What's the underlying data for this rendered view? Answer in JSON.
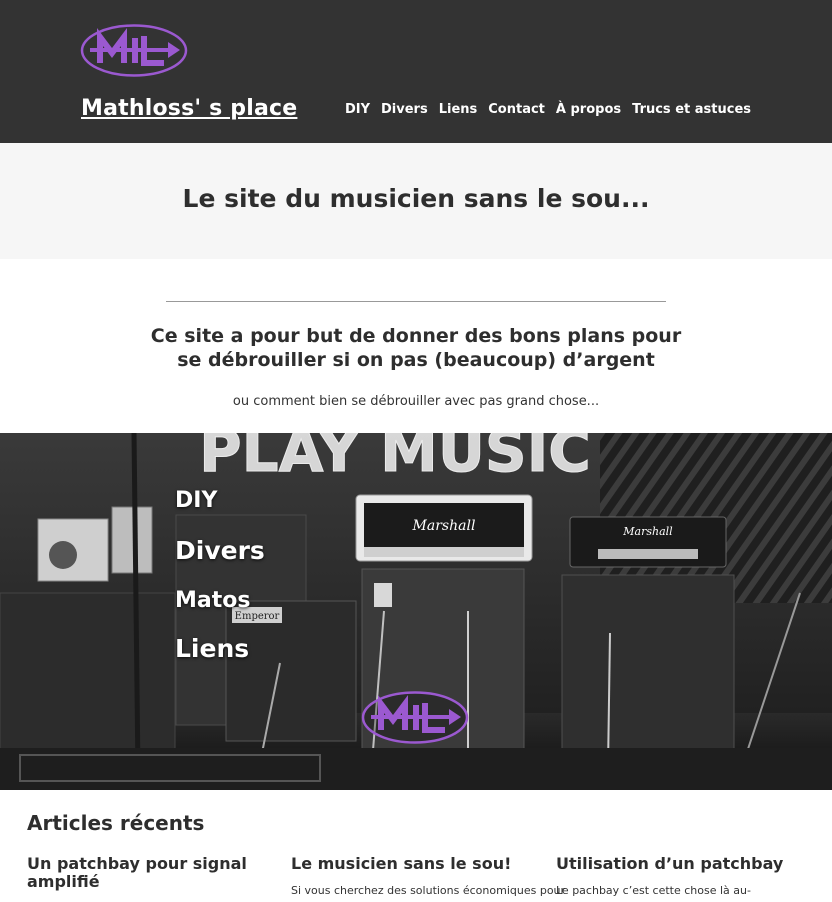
{
  "header": {
    "logo_text": "M+L",
    "site_title": "Mathloss' s place",
    "nav": [
      {
        "label": "DIY"
      },
      {
        "label": "Divers"
      },
      {
        "label": "Liens"
      },
      {
        "label": "Contact"
      },
      {
        "label": "À propos"
      },
      {
        "label": "Trucs et astuces"
      }
    ]
  },
  "tagline": "Le site du musicien sans le sou...",
  "intro": {
    "heading_line1": "Ce site a pour but de donner des bons plans pour",
    "heading_line2": "se débrouiller si on pas (beaucoup) d’argent",
    "subtext": "ou comment bien se débrouiller avec pas grand chose..."
  },
  "hero": {
    "sign_text": "PLAY MUSIC",
    "amp_brand": "Marshall",
    "amp_brand_2": "Marshall",
    "amp_brand_left": "Emperor",
    "menu": [
      {
        "label": "DIY"
      },
      {
        "label": "Divers"
      },
      {
        "label": "Matos"
      },
      {
        "label": "Liens"
      }
    ],
    "logo_text": "M+L"
  },
  "articles": {
    "title": "Articles récents",
    "items": [
      {
        "title": "Un patchbay pour signal amplifié",
        "excerpt": ""
      },
      {
        "title": "Le musicien sans le sou!",
        "excerpt": "Si vous cherchez des solutions économiques pour"
      },
      {
        "title": "Utilisation d’un patchbay",
        "excerpt": "Le pachbay c’est cette chose là au-"
      }
    ]
  },
  "colors": {
    "header_bg": "#333333",
    "band_bg": "#f6f6f6",
    "logo_purple": "#9b59d0",
    "text_dark": "#2e2e2e"
  }
}
